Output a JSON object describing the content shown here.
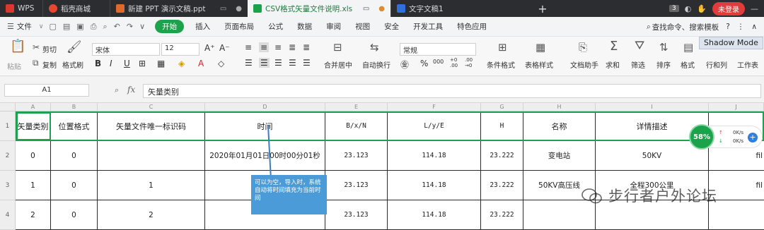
{
  "titlebar": {
    "tabs": [
      {
        "label": "WPS",
        "icon": "wps-logo-icon",
        "color": "#d9382f"
      },
      {
        "label": "稻壳商城",
        "icon": "docer-icon",
        "color": "#e8472f"
      },
      {
        "label": "新建 PPT 演示文稿.ppt",
        "icon": "ppt-icon",
        "color": "#e0682b"
      },
      {
        "label": "CSV格式矢量文件说明.xls",
        "icon": "xls-icon",
        "color": "#1aa34a"
      },
      {
        "label": "文字文稿1",
        "icon": "doc-icon",
        "color": "#2f6fde"
      }
    ],
    "badge": "3",
    "login_label": "未登录"
  },
  "menubar": {
    "file": "文件",
    "start": "开始",
    "items": [
      "插入",
      "页面布局",
      "公式",
      "数据",
      "审阅",
      "视图",
      "安全",
      "开发工具",
      "特色应用"
    ],
    "search": "查找命令、搜索模板"
  },
  "ribbon": {
    "paste": "粘贴",
    "cut": "剪切",
    "copy": "复制",
    "format_painter": "格式刷",
    "font_name": "宋体",
    "font_size": "12",
    "merge": "合并居中",
    "wrap": "自动换行",
    "number_format": "常规",
    "cond_format": "条件格式",
    "table_style": "表格样式",
    "doc_helper": "文档助手",
    "sum": "求和",
    "filter": "筛选",
    "sort": "排序",
    "format": "格式",
    "rowcol": "行和列",
    "worksheet": "工作表",
    "shadow_mode": "Shadow Mode"
  },
  "formula_bar": {
    "name_box": "A1",
    "fx": "fx",
    "content": "矢量类别"
  },
  "grid": {
    "columns": [
      "A",
      "B",
      "C",
      "D",
      "E",
      "F",
      "G",
      "H",
      "I",
      "J"
    ],
    "rows": [
      "1",
      "2",
      "3",
      "4"
    ],
    "header": [
      "矢量类别",
      "位置格式",
      "矢量文件唯一标识码",
      "时间",
      "B/x/N",
      "L/y/E",
      "H",
      "名称",
      "详情描述",
      ""
    ],
    "data": [
      [
        "0",
        "0",
        "",
        "2020年01月01日00时00分01秒",
        "23.123",
        "114.18",
        "23.222",
        "变电站",
        "50KV",
        "fil"
      ],
      [
        "1",
        "0",
        "1",
        "",
        "23.123",
        "114.18",
        "23.222",
        "50KV高压线",
        "全程300公里",
        "fil"
      ],
      [
        "2",
        "0",
        "2",
        "",
        "23.123",
        "114.18",
        "23.222",
        "",
        "",
        ""
      ]
    ]
  },
  "comment": "可以为空，导入时，系统自动将时间填充为当前时间",
  "speed_widget": {
    "percent": "58%",
    "up": "0K/s",
    "down": "0K/s"
  },
  "watermark": "步行者户外论坛"
}
